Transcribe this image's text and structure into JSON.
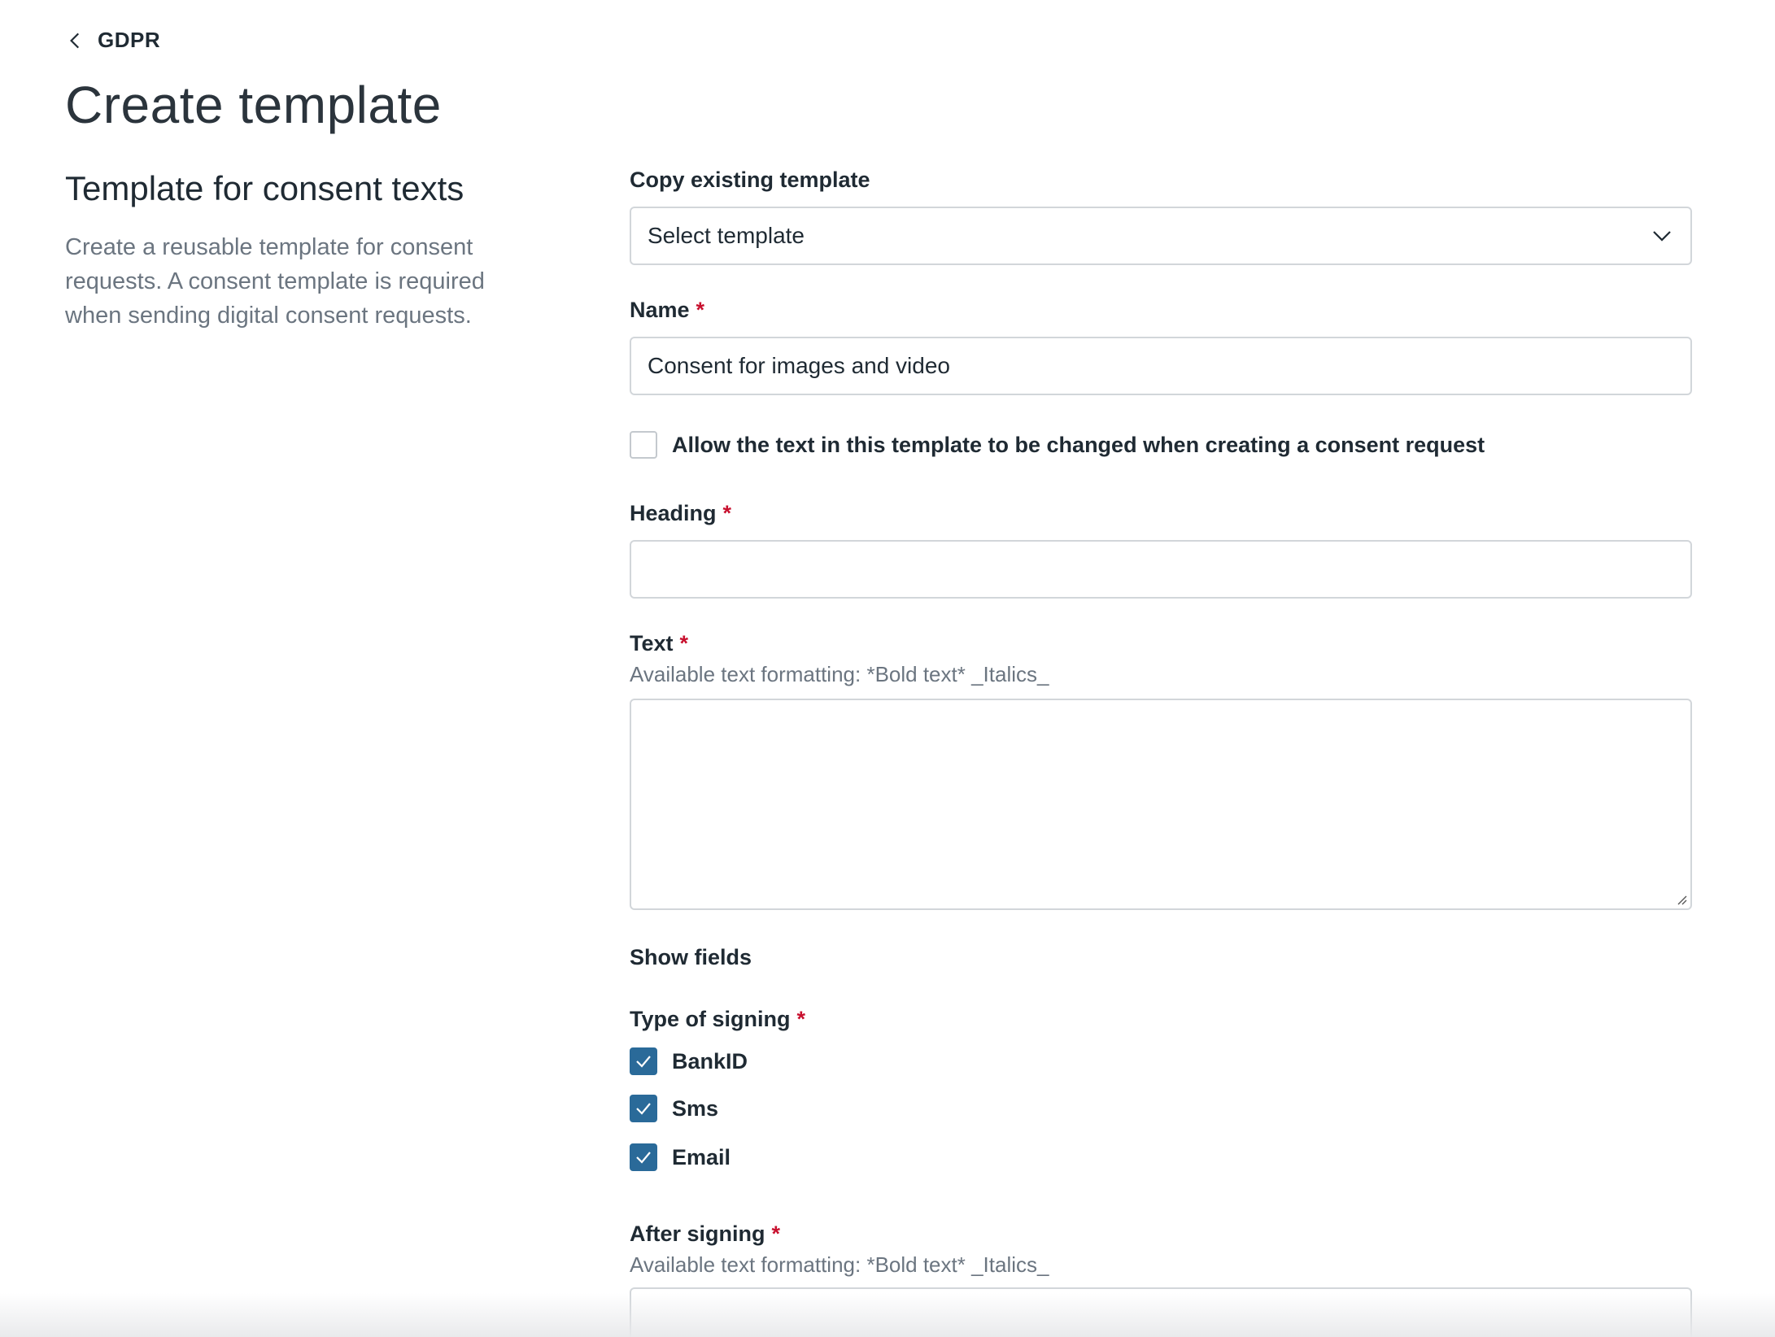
{
  "header": {
    "back_label": "GDPR",
    "page_title": "Create template"
  },
  "sidebar": {
    "title": "Template for consent texts",
    "description": "Create a reusable template for consent requests. A consent template is required when sending digital consent requests."
  },
  "form": {
    "required_marker": "*",
    "copy_template": {
      "label": "Copy existing template",
      "selected_value": "Select template"
    },
    "name": {
      "label": "Name",
      "value": "Consent for images and video"
    },
    "allow_change": {
      "label": "Allow the text in this template to be changed when creating a consent request",
      "checked": false
    },
    "heading": {
      "label": "Heading",
      "value": ""
    },
    "text": {
      "label": "Text",
      "hint": "Available text formatting: *Bold text* _Italics_"
    },
    "show_fields_label": "Show fields",
    "signing": {
      "label": "Type of signing",
      "options": [
        {
          "label": "BankID",
          "checked": true
        },
        {
          "label": "Sms",
          "checked": true
        },
        {
          "label": "Email",
          "checked": true
        }
      ]
    },
    "after_signing": {
      "label": "After signing",
      "hint": "Available text formatting: *Bold text* _Italics_"
    }
  },
  "colors": {
    "accent": "#2a6a99",
    "required": "#c8102e",
    "muted_text": "#6b7580",
    "border": "#d2d6da"
  },
  "icons": {
    "back": "chevron-left-icon",
    "dropdown": "chevron-down-icon",
    "check": "checkmark-icon"
  }
}
